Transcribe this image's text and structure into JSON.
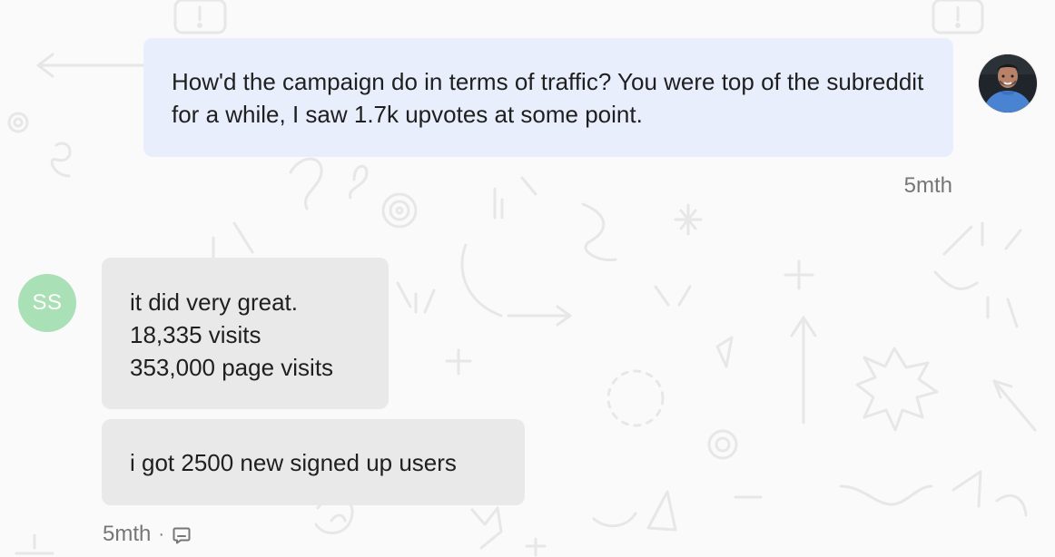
{
  "conversation": {
    "outgoing_message": {
      "text": "How'd the campaign do in terms of traffic? You were top of the subreddit for a while, I saw 1.7k upvotes at some point.",
      "timestamp": "5mth"
    },
    "incoming_messages": [
      {
        "lines": [
          "it did very great.",
          "18,335 visits",
          "353,000 page visits"
        ]
      },
      {
        "lines": [
          "i got 2500 new signed up users"
        ]
      }
    ],
    "incoming_meta": {
      "timestamp": "5mth",
      "separator": "·"
    },
    "participants": {
      "incoming_initials": "SS"
    }
  },
  "icons": {
    "comment": "comment-icon",
    "avatar": "avatar"
  },
  "colors": {
    "page_background": "#fafafa",
    "outgoing_bubble": "#e8eefc",
    "incoming_bubble": "#e9e9e9",
    "avatar_initials_bg": "#a9e0b5",
    "meta_text": "#767676"
  }
}
